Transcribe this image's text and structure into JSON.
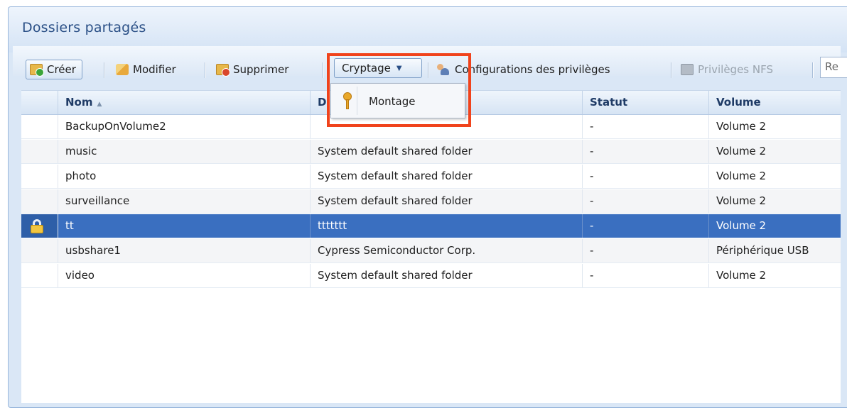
{
  "panel": {
    "title": "Dossiers partagés"
  },
  "toolbar": {
    "create": "Créer",
    "modify": "Modifier",
    "delete": "Supprimer",
    "encryption": "Cryptage",
    "privileges": "Configurations des privilèges",
    "nfs": "Privilèges NFS",
    "search_partial": "Re"
  },
  "dropdown": {
    "mount": "Montage"
  },
  "grid": {
    "headers": {
      "name": "Nom",
      "description": "D",
      "status": "Statut",
      "volume": "Volume"
    },
    "rows": [
      {
        "name": "BackupOnVolume2",
        "description": "",
        "status": "-",
        "volume": "Volume 2"
      },
      {
        "name": "music",
        "description": "System default shared folder",
        "status": "-",
        "volume": "Volume 2"
      },
      {
        "name": "photo",
        "description": "System default shared folder",
        "status": "-",
        "volume": "Volume 2"
      },
      {
        "name": "surveillance",
        "description": "System default shared folder",
        "status": "-",
        "volume": "Volume 2"
      },
      {
        "name": "tt",
        "description": "ttttttt",
        "status": "-",
        "volume": "Volume 2"
      },
      {
        "name": "usbshare1",
        "description": "Cypress Semiconductor Corp.",
        "status": "-",
        "volume": "Périphérique USB"
      },
      {
        "name": "video",
        "description": "System default shared folder",
        "status": "-",
        "volume": "Volume 2"
      }
    ]
  },
  "colors": {
    "highlight": "#f0431c",
    "selected_row": "#3a6fc0"
  }
}
